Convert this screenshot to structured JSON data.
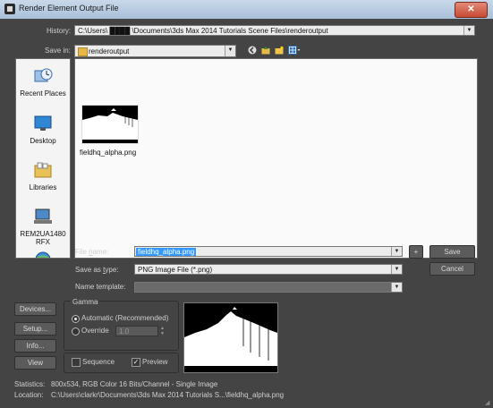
{
  "window": {
    "title": "Render Element Output File",
    "close_glyph": "✕"
  },
  "history": {
    "label": "History:",
    "value": "C:\\Users\\ ████ \\Documents\\3ds Max 2014 Tutorials Scene Files\\renderoutput"
  },
  "save_in": {
    "label": "Save in:",
    "value": "renderoutput"
  },
  "places": [
    {
      "label": "Recent Places",
      "icon": "recent-places-icon"
    },
    {
      "label": "Desktop",
      "icon": "desktop-icon"
    },
    {
      "label": "Libraries",
      "icon": "libraries-icon"
    },
    {
      "label": "REM2UA1480RFX",
      "icon": "computer-icon"
    },
    {
      "label": "",
      "icon": "network-icon"
    }
  ],
  "files": [
    {
      "name": "fieldhq_alpha.png"
    }
  ],
  "file_name": {
    "label": "File name:",
    "value": "fieldhq_alpha.png"
  },
  "save_as_type": {
    "label": "Save as type:",
    "value": "PNG Image File (*.png)"
  },
  "name_template": {
    "label": "Name template:",
    "value": ""
  },
  "plus_button": "+",
  "save_button": "Save",
  "cancel_button": "Cancel",
  "side_buttons": {
    "devices": "Devices...",
    "setup": "Setup...",
    "info": "Info...",
    "view": "View"
  },
  "gamma": {
    "title": "Gamma",
    "automatic": "Automatic (Recommended)",
    "override": "Override",
    "override_value": "1.0"
  },
  "sequence_label": "Sequence",
  "preview_label": "Preview",
  "preview_checked": true,
  "sequence_checked": false,
  "statistics": {
    "label": "Statistics:",
    "value": "800x534, RGB Color 16 Bits/Channel - Single Image"
  },
  "location": {
    "label": "Location:",
    "value": "C:\\Users\\clarkr\\Documents\\3ds Max 2014 Tutorials S...\\fieldhq_alpha.png"
  },
  "colors": {
    "accent": "#3399ff",
    "background": "#444444"
  }
}
